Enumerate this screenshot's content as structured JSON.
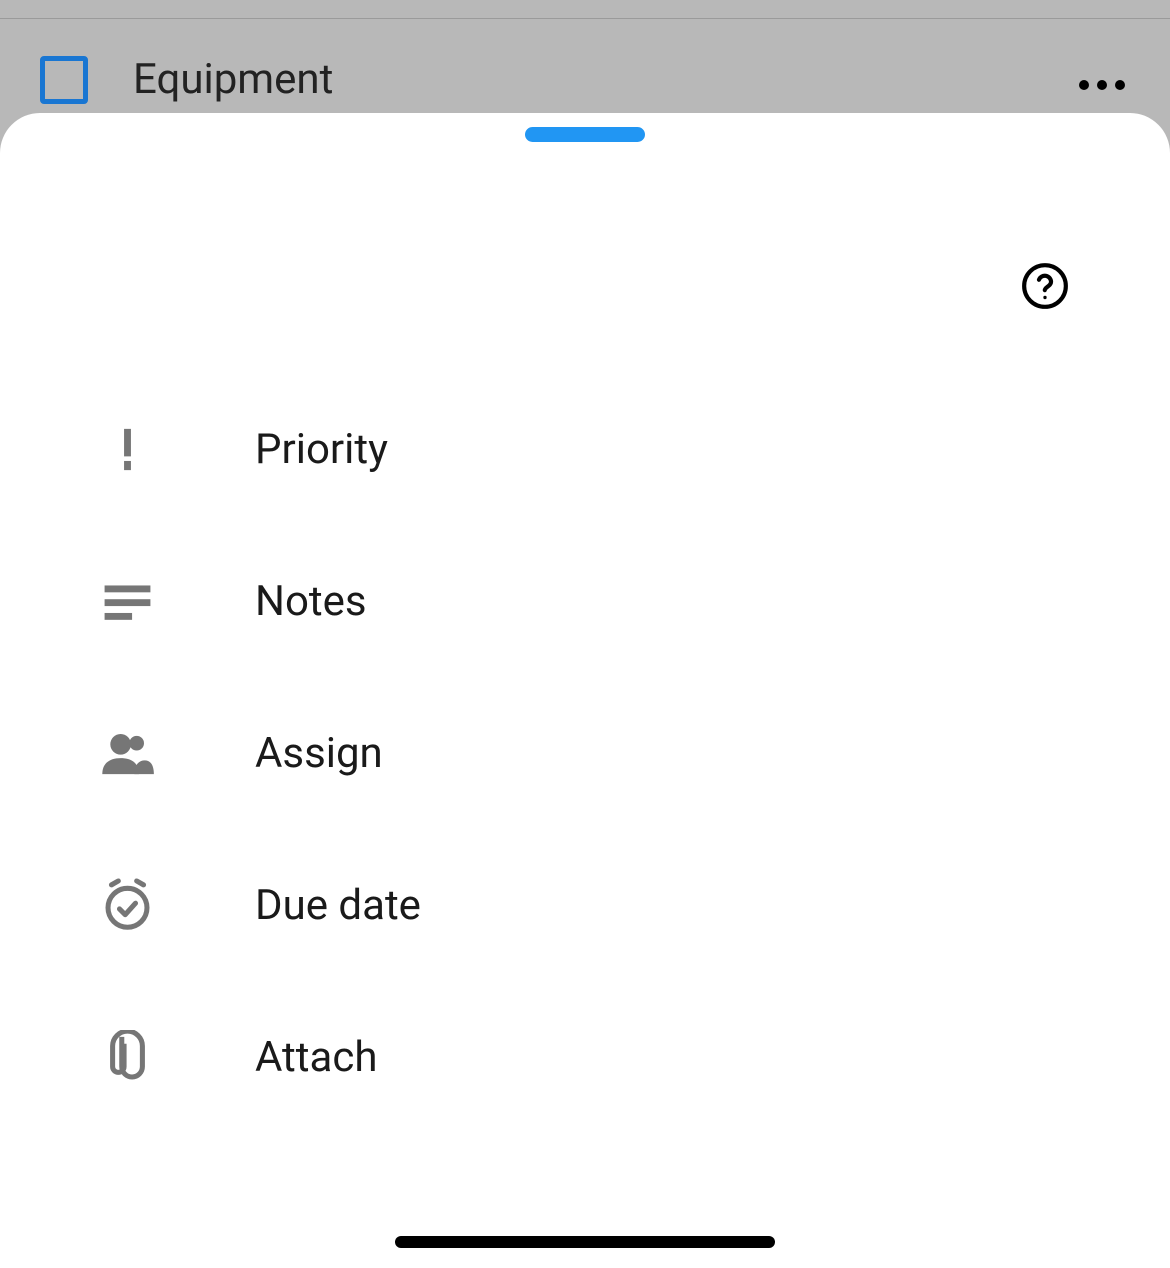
{
  "background": {
    "task_title": "Equipment"
  },
  "menu": {
    "items": [
      {
        "label": "Priority",
        "icon": "priority-icon"
      },
      {
        "label": "Notes",
        "icon": "notes-icon"
      },
      {
        "label": "Assign",
        "icon": "assign-icon"
      },
      {
        "label": "Due date",
        "icon": "due-date-icon"
      },
      {
        "label": "Attach",
        "icon": "attach-icon"
      }
    ]
  }
}
